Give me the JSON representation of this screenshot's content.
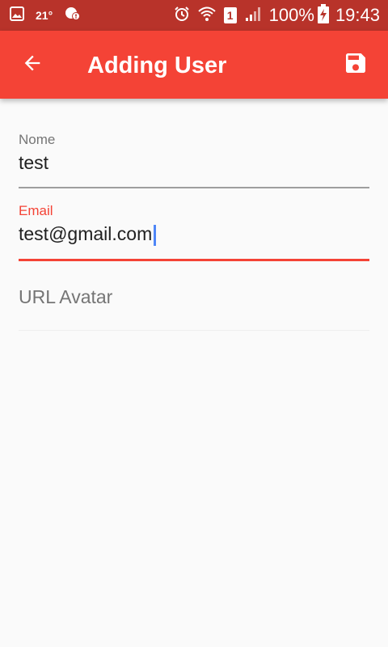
{
  "status_bar": {
    "temperature": "21°",
    "battery": "100%",
    "sim": "1",
    "time": "19:43",
    "icons": [
      "gallery-icon",
      "weather-icon",
      "alert-icon",
      "alarm-icon",
      "wifi-icon",
      "signal-icon",
      "battery-charging-icon"
    ]
  },
  "app_bar": {
    "title": "Adding User",
    "back_icon": "arrow-back-icon",
    "save_icon": "save-icon",
    "color": "#f44336"
  },
  "form": {
    "name_field": {
      "label": "Nome",
      "value": "test"
    },
    "email_field": {
      "label": "Email",
      "value": "test@gmail.com",
      "focused": true
    },
    "avatar_field": {
      "placeholder": "URL Avatar",
      "value": ""
    }
  },
  "colors": {
    "status_bar": "#b8332a",
    "accent": "#f44336",
    "cursor": "#4f86f7",
    "background": "#fafafa"
  }
}
